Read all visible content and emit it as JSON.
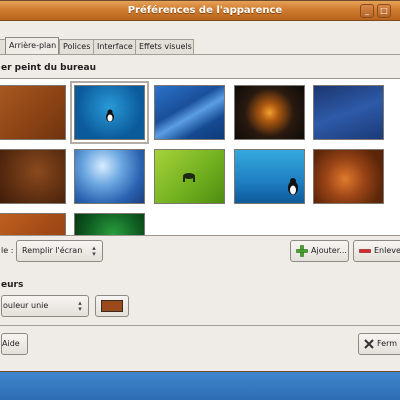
{
  "window": {
    "title": "Préférences de l'apparence"
  },
  "tabs": [
    {
      "label": "Arrière-plan"
    },
    {
      "label": "Polices"
    },
    {
      "label": "Interface"
    },
    {
      "label": "Effets visuels"
    }
  ],
  "wallpaper": {
    "section_title": "er peint du bureau",
    "thumbnails": [
      {
        "name": "brown-wallpaper"
      },
      {
        "name": "tux-blue-wallpaper"
      },
      {
        "name": "blue-curves-wallpaper"
      },
      {
        "name": "orange-light-wallpaper"
      },
      {
        "name": "dark-blue-wallpaper"
      },
      {
        "name": "brown-texture-wallpaper"
      },
      {
        "name": "blue-light-wallpaper"
      },
      {
        "name": "green-wallpaper"
      },
      {
        "name": "cyan-tux-wallpaper"
      },
      {
        "name": "brown-swirl-wallpaper"
      },
      {
        "name": "orange-brown-wallpaper"
      },
      {
        "name": "green-dark-wallpaper"
      }
    ]
  },
  "style": {
    "label": "le :",
    "selected": "Remplir l'écran"
  },
  "actions": {
    "add_label": "Ajouter...",
    "remove_label": "Enlever"
  },
  "colors": {
    "section_title": "eurs",
    "selected": "ouleur unie",
    "swatch_color": "#9a4a1c"
  },
  "footer": {
    "help_label": "Aide",
    "close_label": "Ferm"
  }
}
